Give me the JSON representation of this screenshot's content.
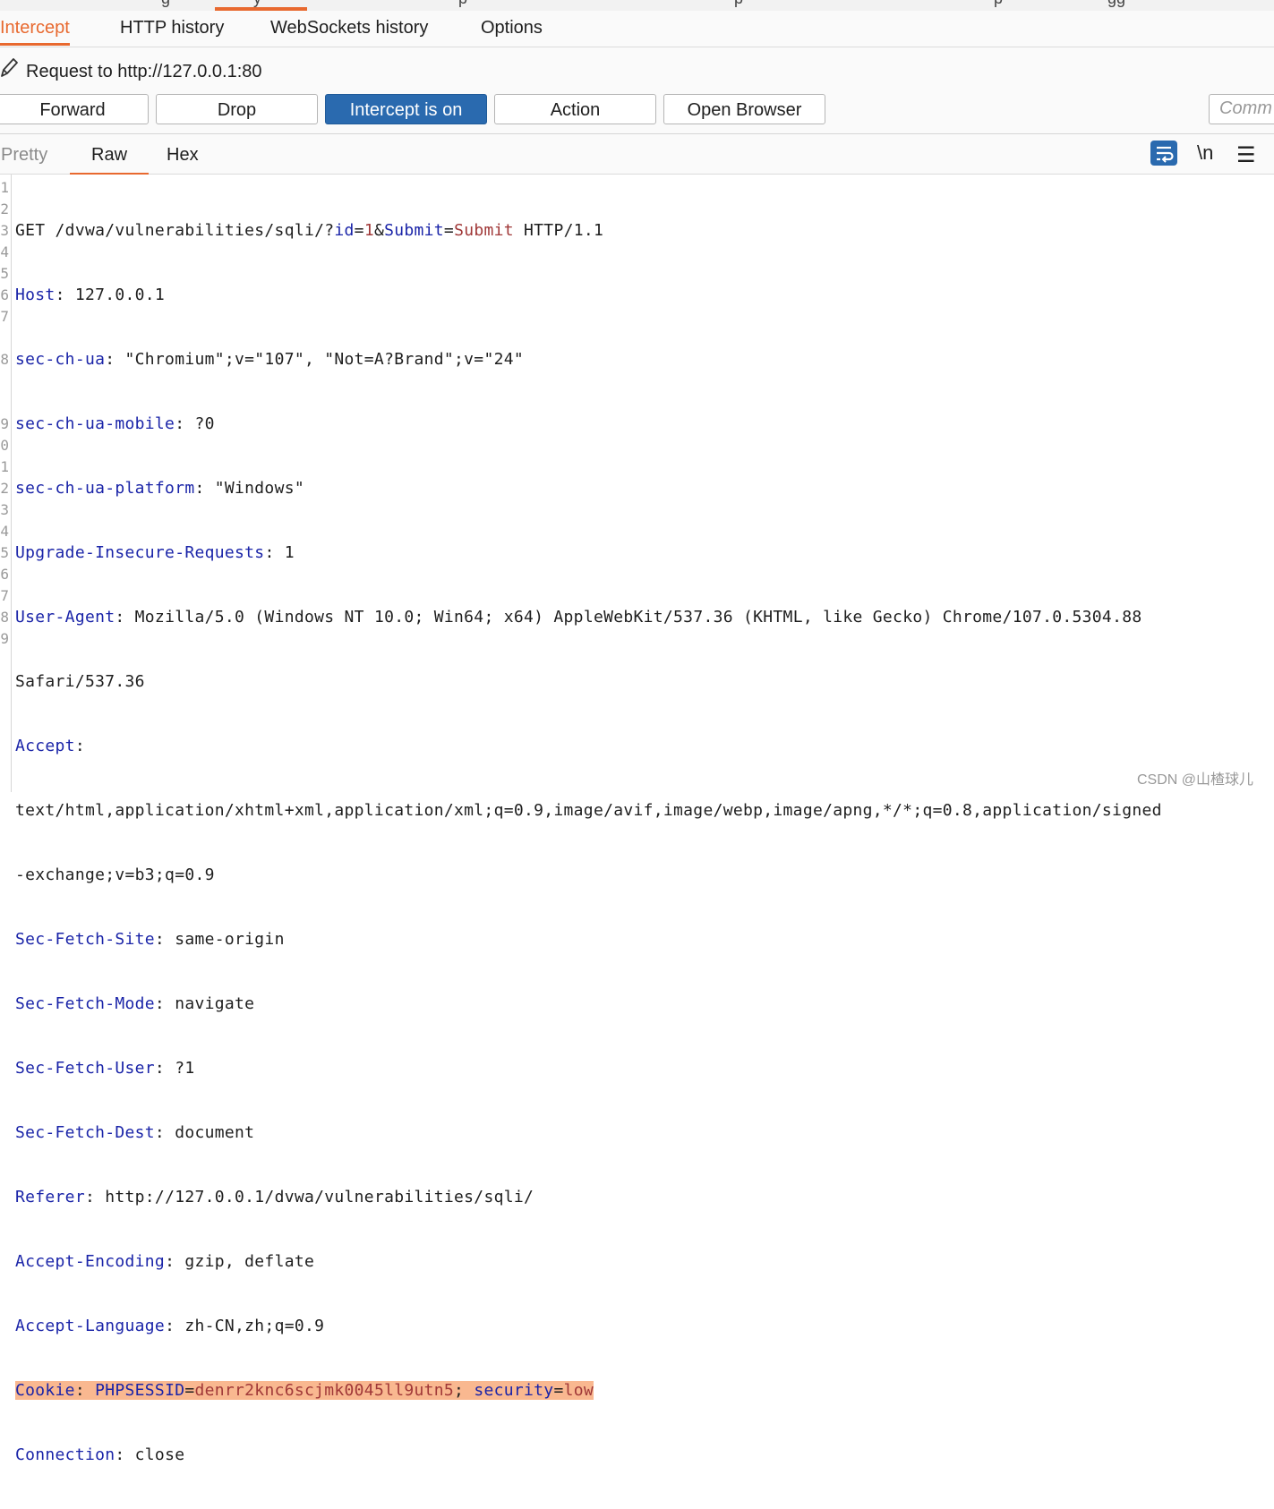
{
  "main_tabs": {
    "visible_glyphs": [
      "g",
      "y",
      "p",
      "p",
      "p",
      "gg"
    ]
  },
  "sub_tabs": [
    {
      "label": "Intercept",
      "active": true
    },
    {
      "label": "HTTP history",
      "active": false
    },
    {
      "label": "WebSockets history",
      "active": false
    },
    {
      "label": "Options",
      "active": false
    }
  ],
  "request_label": "Request to http://127.0.0.1:80",
  "buttons": {
    "forward": "Forward",
    "drop": "Drop",
    "intercept": "Intercept is on",
    "action": "Action",
    "open_browser": "Open Browser"
  },
  "comment_placeholder": "Comm",
  "view_tabs": {
    "pretty": "Pretty",
    "raw": "Raw",
    "hex": "Hex",
    "active": "Raw"
  },
  "toolbar_icons": {
    "wrap": "text-wrap-icon",
    "newline": "\\n",
    "menu": "hamburger-menu-icon"
  },
  "editor": {
    "line_numbers": [
      "1",
      "2",
      "3",
      "4",
      "5",
      "6",
      "7",
      "",
      "8",
      "",
      "9",
      "0",
      "1",
      "2",
      "3",
      "4",
      "5",
      "6",
      "7",
      "8",
      "9"
    ],
    "request_line": {
      "method_path": "GET /dvwa/vulnerabilities/sqli/?",
      "p1_name": "id",
      "p1_value": "1",
      "p2_name": "Submit",
      "p2_value": "Submit",
      "version": " HTTP/1.1"
    },
    "headers": [
      {
        "name": "Host",
        "value": " 127.0.0.1"
      },
      {
        "name": "sec-ch-ua",
        "value": " \"Chromium\";v=\"107\", \"Not=A?Brand\";v=\"24\""
      },
      {
        "name": "sec-ch-ua-mobile",
        "value": " ?0"
      },
      {
        "name": "sec-ch-ua-platform",
        "value": " \"Windows\""
      },
      {
        "name": "Upgrade-Insecure-Requests",
        "value": " 1"
      },
      {
        "name": "User-Agent",
        "value": " Mozilla/5.0 (Windows NT 10.0; Win64; x64) AppleWebKit/537.36 (KHTML, like Gecko) Chrome/107.0.5304.88",
        "cont": "Safari/537.36"
      },
      {
        "name": "Accept",
        "value": "",
        "cont": "text/html,application/xhtml+xml,application/xml;q=0.9,image/avif,image/webp,image/apng,*/*;q=0.8,application/signed",
        "cont2": "-exchange;v=b3;q=0.9"
      },
      {
        "name": "Sec-Fetch-Site",
        "value": " same-origin"
      },
      {
        "name": "Sec-Fetch-Mode",
        "value": " navigate"
      },
      {
        "name": "Sec-Fetch-User",
        "value": " ?1"
      },
      {
        "name": "Sec-Fetch-Dest",
        "value": " document"
      },
      {
        "name": "Referer",
        "value": " http://127.0.0.1/dvwa/vulnerabilities/sqli/"
      },
      {
        "name": "Accept-Encoding",
        "value": " gzip, deflate"
      },
      {
        "name": "Accept-Language",
        "value": " zh-CN,zh;q=0.9"
      }
    ],
    "cookie": {
      "name": "Cookie",
      "c1_name": "PHPSESSID",
      "c1_value": "denrr2knc6scjmk0045ll9utn5",
      "c2_name": "security",
      "c2_value": "low"
    },
    "connection": {
      "name": "Connection",
      "value": " close"
    }
  },
  "watermark": "CSDN @山楂球儿"
}
